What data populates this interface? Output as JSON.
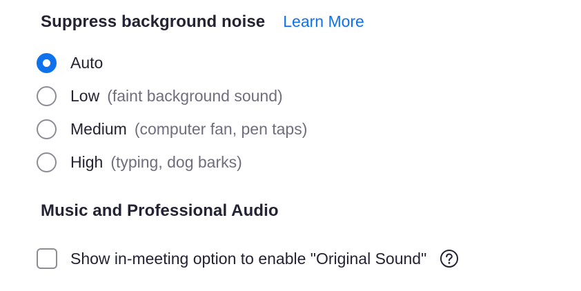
{
  "noise": {
    "title": "Suppress background noise",
    "learn_more": "Learn More",
    "options": [
      {
        "label": "Auto",
        "hint": "",
        "selected": true
      },
      {
        "label": "Low",
        "hint": "(faint background sound)",
        "selected": false
      },
      {
        "label": "Medium",
        "hint": "(computer fan, pen taps)",
        "selected": false
      },
      {
        "label": "High",
        "hint": "(typing, dog barks)",
        "selected": false
      }
    ]
  },
  "music": {
    "title": "Music and Professional Audio",
    "original_sound": {
      "label": "Show in-meeting option to enable \"Original Sound\"",
      "checked": false,
      "help_icon": "question-circle-icon"
    }
  },
  "colors": {
    "accent": "#0e72ed",
    "text": "#232333",
    "hint": "#6e6e7e",
    "control_border": "#8c8c95"
  }
}
